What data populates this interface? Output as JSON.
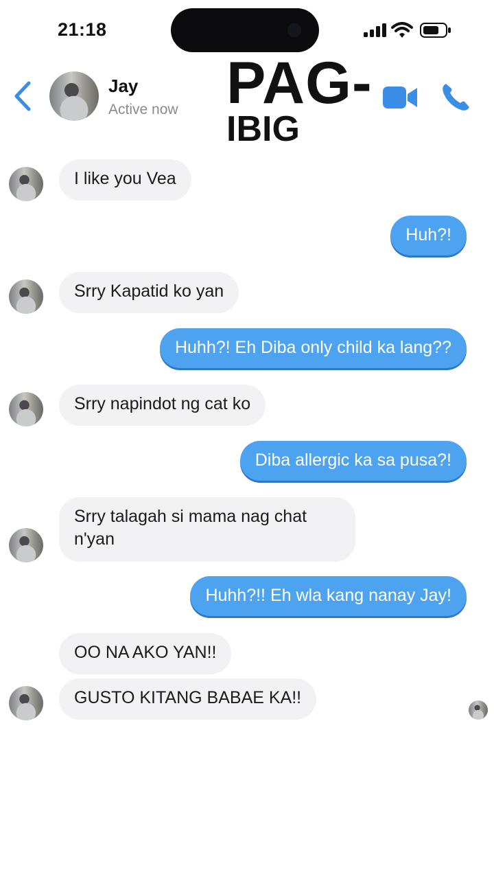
{
  "status_bar": {
    "time": "21:18"
  },
  "header": {
    "contact_name": "Jay",
    "presence": "Active now",
    "overlay_title_line1": "PAG-",
    "overlay_title_line2": "IBIG",
    "icons": [
      "back-chevron-icon",
      "video-call-icon",
      "phone-call-icon"
    ]
  },
  "colors": {
    "accent": "#4ea3f0",
    "incoming_bubble": "#f2f2f4",
    "outgoing_text": "#ffffff"
  },
  "messages": [
    {
      "from": "Jay",
      "text": "I like you Vea"
    },
    {
      "from": "me",
      "text": "Huh?!"
    },
    {
      "from": "Jay",
      "text": "Srry Kapatid ko yan"
    },
    {
      "from": "me",
      "text": "Huhh?! Eh Diba only child ka lang??"
    },
    {
      "from": "Jay",
      "text": "Srry napindot ng cat ko"
    },
    {
      "from": "me",
      "text": "Diba allergic ka sa pusa?!"
    },
    {
      "from": "Jay",
      "text": "Srry talagah si mama nag chat n'yan"
    },
    {
      "from": "me",
      "text": "Huhh?!! Eh wla kang nanay Jay!"
    },
    {
      "from": "Jay",
      "text": "OO NA AKO YAN!!"
    },
    {
      "from": "Jay",
      "text": "GUSTO KITANG BABAE KA!!"
    }
  ]
}
